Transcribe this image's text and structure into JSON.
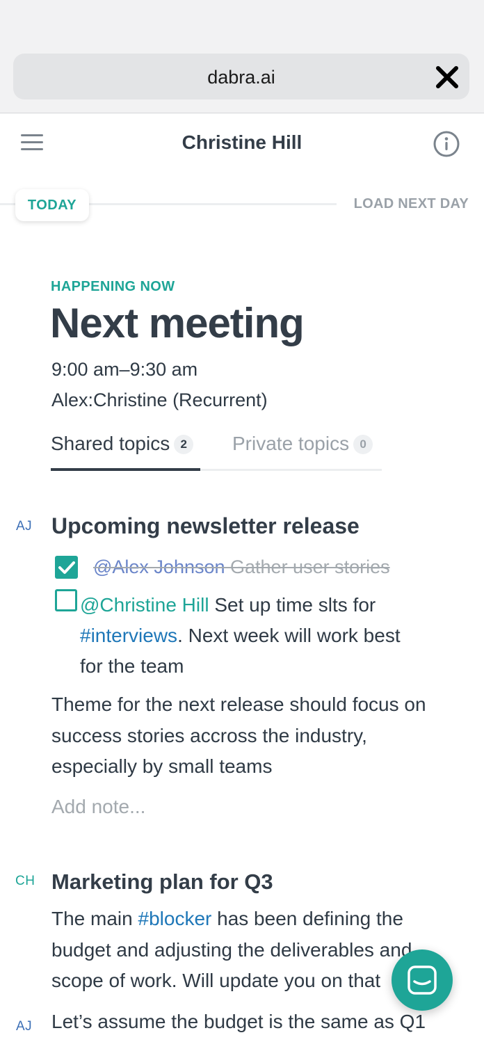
{
  "browser": {
    "url": "dabra.ai",
    "close_icon": "close-icon"
  },
  "header": {
    "title": "Christine Hill",
    "menu_icon": "hamburger-menu-icon",
    "info_icon": "info-icon"
  },
  "daybar": {
    "today_label": "TODAY",
    "load_next_label": "LOAD NEXT DAY"
  },
  "meeting": {
    "status": "HAPPENING NOW",
    "title": "Next meeting",
    "time": "9:00 am–9:30 am",
    "name": "Alex:Christine (Recurrent)"
  },
  "tabs": [
    {
      "label": "Shared topics",
      "count": "2",
      "active": true
    },
    {
      "label": "Private topics",
      "count": "0",
      "active": false
    }
  ],
  "topics": [
    {
      "author": "AJ",
      "title": "Upcoming newsletter release",
      "items": [
        {
          "done": true,
          "mention": "@Alex Johnson",
          "text": " Gather user stories"
        },
        {
          "done": false,
          "mention": "@Christine Hill",
          "text_before": " Set up time slts for ",
          "hashtag": "#interviews",
          "text_after": ". Next week will work best for the team"
        }
      ],
      "note": "Theme for the next release should focus on success stories accross the industry, especially by small teams",
      "add_note_placeholder": "Add note..."
    },
    {
      "author": "CH",
      "title": "Marketing plan for Q3",
      "note_before": "The main ",
      "hashtag": "#blocker",
      "note_after": " has been defining the budget and adjusting the deliverables and scope of work. Will update you on that"
    }
  ],
  "reply": {
    "author": "AJ",
    "text": "Let’s assume the budget is the same as Q1"
  },
  "colors": {
    "accent": "#1ea597",
    "text": "#333d48",
    "muted": "#9aa1a8",
    "link": "#1e77b8"
  },
  "fab_icon": "chat-icon"
}
